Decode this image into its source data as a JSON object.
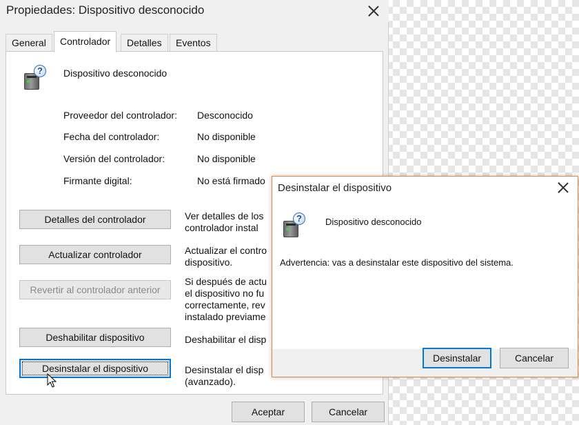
{
  "props_window": {
    "title": "Propiedades: Dispositivo desconocido",
    "tabs": [
      {
        "label": "General"
      },
      {
        "label": "Controlador"
      },
      {
        "label": "Detalles"
      },
      {
        "label": "Eventos"
      }
    ],
    "device_name": "Dispositivo desconocido",
    "properties": [
      {
        "label": "Proveedor del controlador:",
        "value": "Desconocido"
      },
      {
        "label": "Fecha del controlador:",
        "value": "No disponible"
      },
      {
        "label": "Versión del controlador:",
        "value": "No disponible"
      },
      {
        "label": "Firmante digital:",
        "value": "No está firmado"
      }
    ],
    "buttons": {
      "driver_details": "Detalles del controlador",
      "update_driver": "Actualizar controlador",
      "rollback_driver": "Revertir al controlador anterior",
      "disable_device": "Deshabilitar dispositivo",
      "uninstall_device": "Desinstalar el dispositivo"
    },
    "descriptions": {
      "driver_details": [
        "Ver detalles de los",
        "controlador instal"
      ],
      "update_driver": [
        "Actualizar el contro",
        "dispositivo."
      ],
      "rollback_driver": [
        "Si después de actu",
        "el dispositivo no fu",
        "correctamente, rev",
        "instalado previame"
      ],
      "disable_device": [
        "Deshabilitar el disp"
      ],
      "uninstall_device": [
        "Desinstalar el disp",
        "(avanzado)."
      ]
    },
    "footer": {
      "ok": "Aceptar",
      "cancel": "Cancelar"
    }
  },
  "uninstall_dialog": {
    "title": "Desinstalar el dispositivo",
    "device_name": "Dispositivo desconocido",
    "warning": "Advertencia: vas a desinstalar este dispositivo del sistema.",
    "uninstall_button": "Desinstalar",
    "cancel_button": "Cancelar"
  },
  "icons": {
    "device_badge": "?"
  },
  "colors": {
    "dialog_border": "#e0893c",
    "focus_blue": "#0078d7"
  }
}
